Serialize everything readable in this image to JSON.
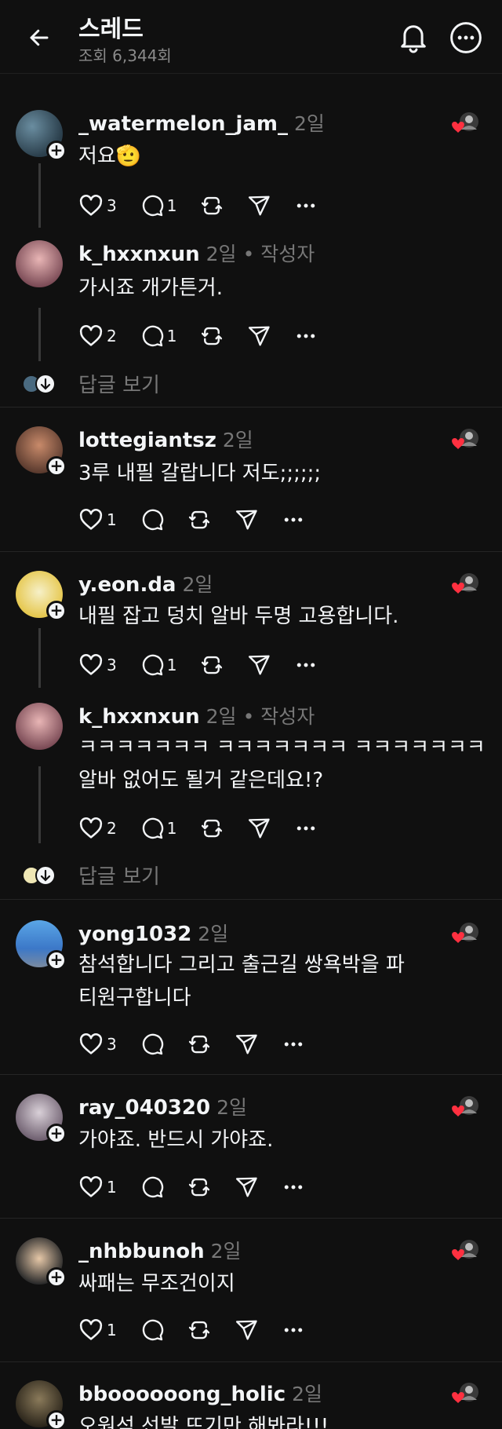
{
  "header": {
    "title": "스레드",
    "views": "조회 6,344회"
  },
  "replies_label": "답글 보기",
  "comments": [
    {
      "username": "_watermelon_jam_",
      "time": "2일",
      "author_tag": "",
      "text": "저요🫡",
      "likes": "3",
      "replies": "1"
    },
    {
      "username": "k_hxxnxun",
      "time": "2일",
      "author_tag": "• 작성자",
      "text": "가시죠 개가튼거.",
      "likes": "2",
      "replies": "1"
    },
    {
      "username": "lottegiantsz",
      "time": "2일",
      "author_tag": "",
      "text": "3루 내필 갈랍니다 저도;;;;;;",
      "likes": "1",
      "replies": ""
    },
    {
      "username": "y.eon.da",
      "time": "2일",
      "author_tag": "",
      "text": "내필 잡고 덩치 알바 두명 고용합니다.",
      "likes": "3",
      "replies": "1"
    },
    {
      "username": "k_hxxnxun",
      "time": "2일",
      "author_tag": "• 작성자",
      "text": "ㅋㅋㅋㅋㅋㅋㅋ ㅋㅋㅋㅋㅋㅋㅋ ㅋㅋㅋㅋㅋㅋㅋ 알바 없어도 될거 같은데요!?",
      "likes": "2",
      "replies": "1"
    },
    {
      "username": "yong1032",
      "time": "2일",
      "author_tag": "",
      "text": "참석합니다 그리고 출근길 쌍욕박을 파티원구합니다",
      "likes": "3",
      "replies": ""
    },
    {
      "username": "ray_040320",
      "time": "2일",
      "author_tag": "",
      "text": "가야죠. 반드시 가야죠.",
      "likes": "1",
      "replies": ""
    },
    {
      "username": "_nhbbunoh",
      "time": "2일",
      "author_tag": "",
      "text": "싸패는 무조건이지",
      "likes": "1",
      "replies": ""
    },
    {
      "username": "bboooooong_holic",
      "time": "2일",
      "author_tag": "",
      "text": "오원석 선발 뜨기만 해봐라!!!",
      "likes": "",
      "replies": ""
    }
  ],
  "colors": {
    "background": "#101010",
    "text": "#f3f5f7",
    "muted": "#777777",
    "heart": "#ff3040"
  }
}
